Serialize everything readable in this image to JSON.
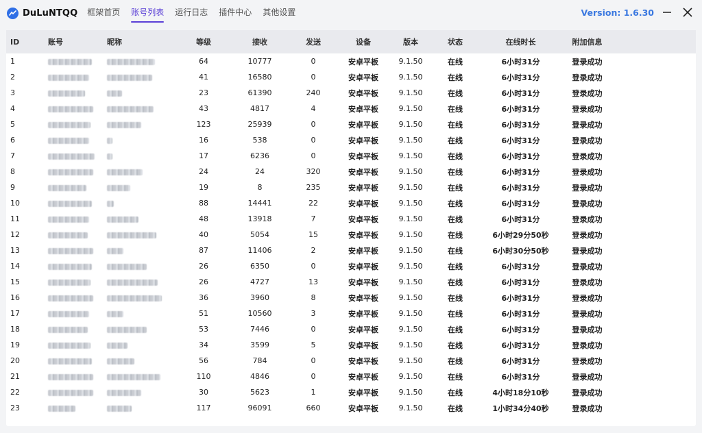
{
  "app": {
    "name": "DuLuNTQQ",
    "version": "Version: 1.6.30"
  },
  "tabs": [
    {
      "label": "框架首页",
      "active": false
    },
    {
      "label": "账号列表",
      "active": true
    },
    {
      "label": "运行日志",
      "active": false
    },
    {
      "label": "插件中心",
      "active": false
    },
    {
      "label": "其他设置",
      "active": false
    }
  ],
  "colors": {
    "accent": "#5a3fd6",
    "version": "#3a78e0",
    "header_bg": "#e9eaee"
  },
  "table": {
    "columns": [
      "ID",
      "账号",
      "昵称",
      "等级",
      "接收",
      "发送",
      "设备",
      "版本",
      "状态",
      "在线时长",
      "附加信息"
    ],
    "rows": [
      {
        "id": "1",
        "level": "64",
        "recv": "10777",
        "send": "0",
        "device": "安卓平板",
        "ver": "9.1.50",
        "status": "在线",
        "online": "6小时31分",
        "info": "登录成功"
      },
      {
        "id": "2",
        "level": "41",
        "recv": "16580",
        "send": "0",
        "device": "安卓平板",
        "ver": "9.1.50",
        "status": "在线",
        "online": "6小时31分",
        "info": "登录成功"
      },
      {
        "id": "3",
        "level": "23",
        "recv": "61390",
        "send": "240",
        "device": "安卓平板",
        "ver": "9.1.50",
        "status": "在线",
        "online": "6小时31分",
        "info": "登录成功"
      },
      {
        "id": "4",
        "level": "43",
        "recv": "4817",
        "send": "4",
        "device": "安卓平板",
        "ver": "9.1.50",
        "status": "在线",
        "online": "6小时31分",
        "info": "登录成功"
      },
      {
        "id": "5",
        "level": "123",
        "recv": "25939",
        "send": "0",
        "device": "安卓平板",
        "ver": "9.1.50",
        "status": "在线",
        "online": "6小时31分",
        "info": "登录成功"
      },
      {
        "id": "6",
        "level": "16",
        "recv": "538",
        "send": "0",
        "device": "安卓平板",
        "ver": "9.1.50",
        "status": "在线",
        "online": "6小时31分",
        "info": "登录成功"
      },
      {
        "id": "7",
        "level": "17",
        "recv": "6236",
        "send": "0",
        "device": "安卓平板",
        "ver": "9.1.50",
        "status": "在线",
        "online": "6小时31分",
        "info": "登录成功"
      },
      {
        "id": "8",
        "level": "24",
        "recv": "24",
        "send": "320",
        "device": "安卓平板",
        "ver": "9.1.50",
        "status": "在线",
        "online": "6小时31分",
        "info": "登录成功"
      },
      {
        "id": "9",
        "level": "19",
        "recv": "8",
        "send": "235",
        "device": "安卓平板",
        "ver": "9.1.50",
        "status": "在线",
        "online": "6小时31分",
        "info": "登录成功"
      },
      {
        "id": "10",
        "level": "88",
        "recv": "14441",
        "send": "22",
        "device": "安卓平板",
        "ver": "9.1.50",
        "status": "在线",
        "online": "6小时31分",
        "info": "登录成功"
      },
      {
        "id": "11",
        "level": "48",
        "recv": "13918",
        "send": "7",
        "device": "安卓平板",
        "ver": "9.1.50",
        "status": "在线",
        "online": "6小时31分",
        "info": "登录成功"
      },
      {
        "id": "12",
        "level": "40",
        "recv": "5054",
        "send": "15",
        "device": "安卓平板",
        "ver": "9.1.50",
        "status": "在线",
        "online": "6小时29分50秒",
        "info": "登录成功"
      },
      {
        "id": "13",
        "level": "87",
        "recv": "11406",
        "send": "2",
        "device": "安卓平板",
        "ver": "9.1.50",
        "status": "在线",
        "online": "6小时30分50秒",
        "info": "登录成功"
      },
      {
        "id": "14",
        "level": "26",
        "recv": "6350",
        "send": "0",
        "device": "安卓平板",
        "ver": "9.1.50",
        "status": "在线",
        "online": "6小时31分",
        "info": "登录成功"
      },
      {
        "id": "15",
        "level": "26",
        "recv": "4727",
        "send": "13",
        "device": "安卓平板",
        "ver": "9.1.50",
        "status": "在线",
        "online": "6小时31分",
        "info": "登录成功"
      },
      {
        "id": "16",
        "level": "36",
        "recv": "3960",
        "send": "8",
        "device": "安卓平板",
        "ver": "9.1.50",
        "status": "在线",
        "online": "6小时31分",
        "info": "登录成功"
      },
      {
        "id": "17",
        "level": "51",
        "recv": "10560",
        "send": "3",
        "device": "安卓平板",
        "ver": "9.1.50",
        "status": "在线",
        "online": "6小时31分",
        "info": "登录成功"
      },
      {
        "id": "18",
        "level": "53",
        "recv": "7446",
        "send": "0",
        "device": "安卓平板",
        "ver": "9.1.50",
        "status": "在线",
        "online": "6小时31分",
        "info": "登录成功"
      },
      {
        "id": "19",
        "level": "34",
        "recv": "3599",
        "send": "5",
        "device": "安卓平板",
        "ver": "9.1.50",
        "status": "在线",
        "online": "6小时31分",
        "info": "登录成功"
      },
      {
        "id": "20",
        "level": "56",
        "recv": "784",
        "send": "0",
        "device": "安卓平板",
        "ver": "9.1.50",
        "status": "在线",
        "online": "6小时31分",
        "info": "登录成功"
      },
      {
        "id": "21",
        "level": "110",
        "recv": "4846",
        "send": "0",
        "device": "安卓平板",
        "ver": "9.1.50",
        "status": "在线",
        "online": "6小时31分",
        "info": "登录成功"
      },
      {
        "id": "22",
        "level": "30",
        "recv": "5623",
        "send": "1",
        "device": "安卓平板",
        "ver": "9.1.50",
        "status": "在线",
        "online": "4小时18分10秒",
        "info": "登录成功"
      },
      {
        "id": "23",
        "level": "117",
        "recv": "96091",
        "send": "660",
        "device": "安卓平板",
        "ver": "9.1.50",
        "status": "在线",
        "online": "1小时34分40秒",
        "info": "登录成功"
      }
    ]
  }
}
